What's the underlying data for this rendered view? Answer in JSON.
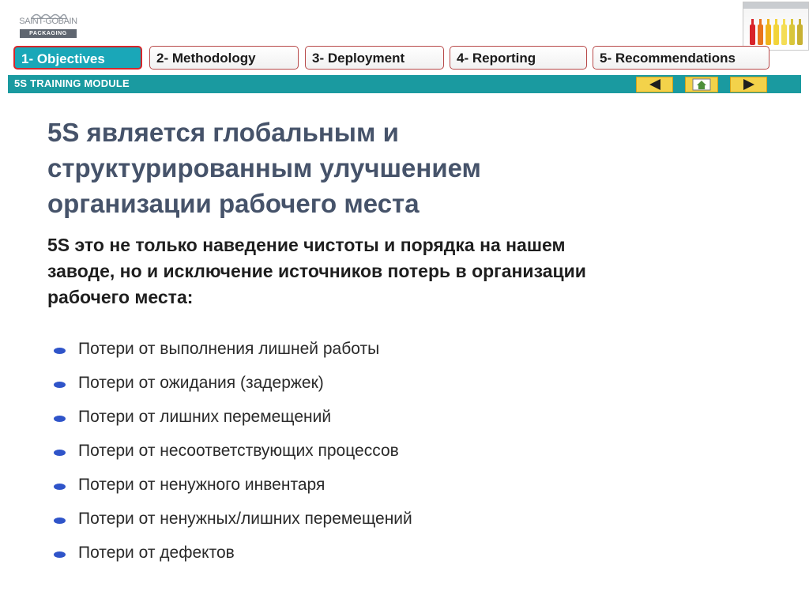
{
  "header": {
    "logo_name": "SAINT-GOBAIN",
    "logo_sub": "PACKAGING"
  },
  "tabs": [
    {
      "label": "1- Objectives",
      "active": true
    },
    {
      "label": "2- Methodology",
      "active": false
    },
    {
      "label": "3- Deployment",
      "active": false
    },
    {
      "label": "4- Reporting",
      "active": false
    },
    {
      "label": "5- Recommendations",
      "active": false
    }
  ],
  "band": {
    "title": "5S TRAINING MODULE"
  },
  "nav_icons": [
    "arrow-left-icon",
    "home-icon",
    "arrow-right-icon"
  ],
  "content": {
    "headline_lines": [
      "5S является глобальным и",
      "структурированным улучшением",
      "организации рабочего места"
    ],
    "sub_lines": [
      "5S это не только наведение чистоты и порядка на нашем",
      "заводе, но и исключение источников потерь в организации",
      "рабочего места:"
    ],
    "bullets": [
      "Потери от выполнения лишней работы",
      "Потери от ожидания (задержек)",
      "Потери от лишних перемещений",
      "Потери от несоответствующих процессов",
      "Потери от ненужного инвентаря",
      "Потери от ненужных/лишних перемещений",
      "Потери от дефектов"
    ]
  },
  "colors": {
    "band": "#1a9aa0",
    "active_tab": "#1aa7b8",
    "active_border": "#d7262b",
    "headline": "#46536a",
    "bullet_dot": "#2f54c9",
    "nav_button": "#f3d24a"
  }
}
